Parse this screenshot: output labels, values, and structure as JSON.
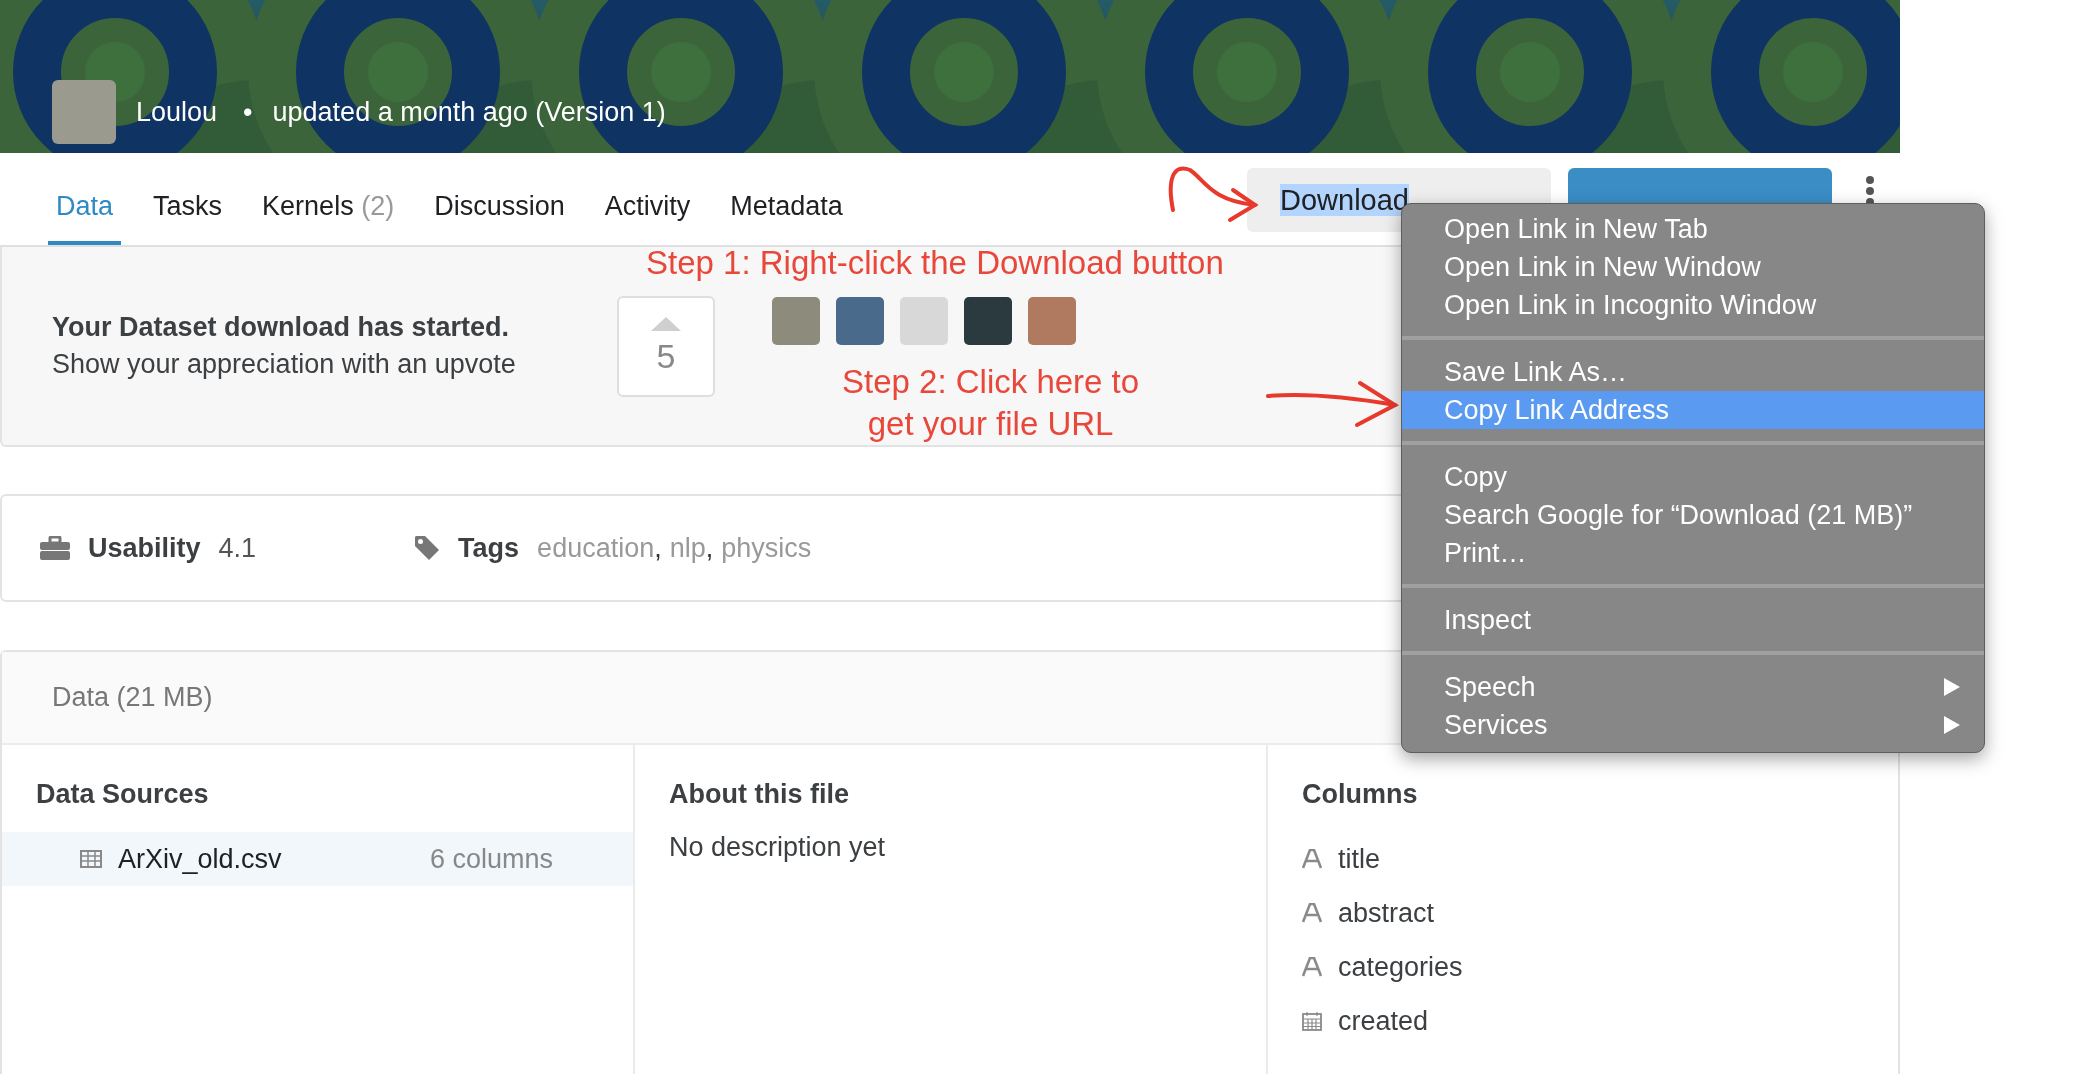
{
  "header": {
    "author": "Loulou",
    "bullet": "•",
    "updated": "updated a month ago (Version 1)"
  },
  "tabs": [
    {
      "label": "Data",
      "selected": true
    },
    {
      "label": "Tasks",
      "selected": false
    },
    {
      "label": "Kernels",
      "count": "(2)",
      "selected": false
    },
    {
      "label": "Discussion",
      "selected": false
    },
    {
      "label": "Activity",
      "selected": false
    },
    {
      "label": "Metadata",
      "selected": false
    }
  ],
  "actions": {
    "download_button": "Download"
  },
  "notice": {
    "title": "Your Dataset download has started.",
    "subtitle": "Show your appreciation with an upvote",
    "upvote_count": "5"
  },
  "usability": {
    "label": "Usability",
    "score": "4.1"
  },
  "tags": {
    "label": "Tags",
    "separator": ",",
    "items": [
      "education",
      "nlp",
      "physics"
    ]
  },
  "data": {
    "title": "Data (21 MB)",
    "sources": {
      "heading": "Data Sources",
      "files": [
        {
          "name": "ArXiv_old.csv",
          "columns": "6 columns",
          "selected": true
        }
      ]
    },
    "about": {
      "heading": "About this file",
      "description": "No description yet"
    },
    "columns": {
      "heading": "Columns",
      "items": [
        {
          "name": "title",
          "kind": "string"
        },
        {
          "name": "abstract",
          "kind": "string"
        },
        {
          "name": "categories",
          "kind": "string"
        },
        {
          "name": "created",
          "kind": "date"
        }
      ]
    }
  },
  "context_menu": {
    "groups": [
      [
        {
          "label": "Open Link in New Tab",
          "selected": false,
          "submenu": false
        },
        {
          "label": "Open Link in New Window",
          "selected": false,
          "submenu": false
        },
        {
          "label": "Open Link in Incognito Window",
          "selected": false,
          "submenu": false
        }
      ],
      [
        {
          "label": "Save Link As…",
          "selected": false,
          "submenu": false
        },
        {
          "label": "Copy Link Address",
          "selected": true,
          "submenu": false
        }
      ],
      [
        {
          "label": "Copy",
          "selected": false,
          "submenu": false
        },
        {
          "label": "Search Google for “Download (21 MB)”",
          "selected": false,
          "submenu": false
        },
        {
          "label": "Print…",
          "selected": false,
          "submenu": false
        }
      ],
      [
        {
          "label": "Inspect",
          "selected": false,
          "submenu": false
        }
      ],
      [
        {
          "label": "Speech",
          "selected": false,
          "submenu": true
        },
        {
          "label": "Services",
          "selected": false,
          "submenu": true
        }
      ]
    ]
  },
  "annotations": [
    {
      "lines": [
        "Step 1: Right-click the Download button"
      ]
    },
    {
      "lines": [
        "Step 2: Click here to",
        "get your file URL"
      ]
    }
  ]
}
